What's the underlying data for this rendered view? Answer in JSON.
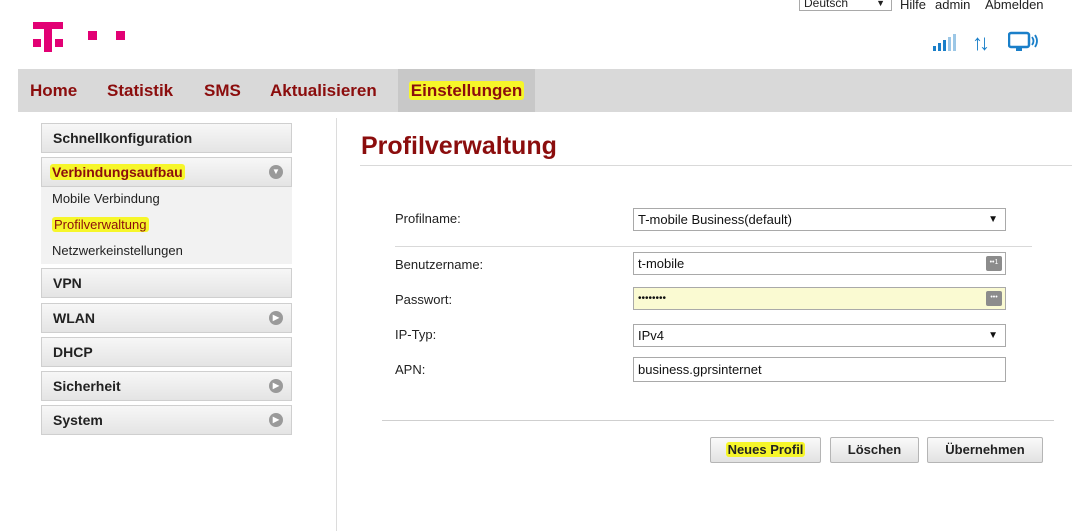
{
  "logo": {
    "brand_color": "#e20074",
    "icon": "telekom-t-logo"
  },
  "topbar": {
    "language": "Deutsch",
    "help": "Hilfe",
    "user": "admin",
    "logout": "Abmelden"
  },
  "status_icons": [
    "signal-strength-icon",
    "data-transfer-icon",
    "connection-monitor-icon"
  ],
  "nav": {
    "items": [
      "Home",
      "Statistik",
      "SMS",
      "Aktualisieren",
      "Einstellungen"
    ],
    "active": "Einstellungen"
  },
  "sidebar": {
    "quick": "Schnellkonfiguration",
    "connection": "Verbindungsaufbau",
    "connection_sub": [
      "Mobile Verbindung",
      "Profilverwaltung",
      "Netzwerkeinstellungen"
    ],
    "vpn": "VPN",
    "wlan": "WLAN",
    "dhcp": "DHCP",
    "security": "Sicherheit",
    "system": "System"
  },
  "main": {
    "title": "Profilverwaltung",
    "profile_label": "Profilname:",
    "profile_value": "T-mobile Business(default)",
    "username_label": "Benutzername:",
    "username_value": "t-mobile",
    "password_label": "Passwort:",
    "password_value": "••••••••",
    "iptype_label": "IP-Typ:",
    "iptype_value": "IPv4",
    "apn_label": "APN:",
    "apn_value": "business.gprsinternet"
  },
  "buttons": {
    "new_profile": "Neues Profil",
    "delete": "Löschen",
    "apply": "Übernehmen"
  },
  "colors": {
    "accent": "#8b0d0d",
    "highlight": "#f6f62a",
    "icon_blue": "#1a7fc9"
  }
}
